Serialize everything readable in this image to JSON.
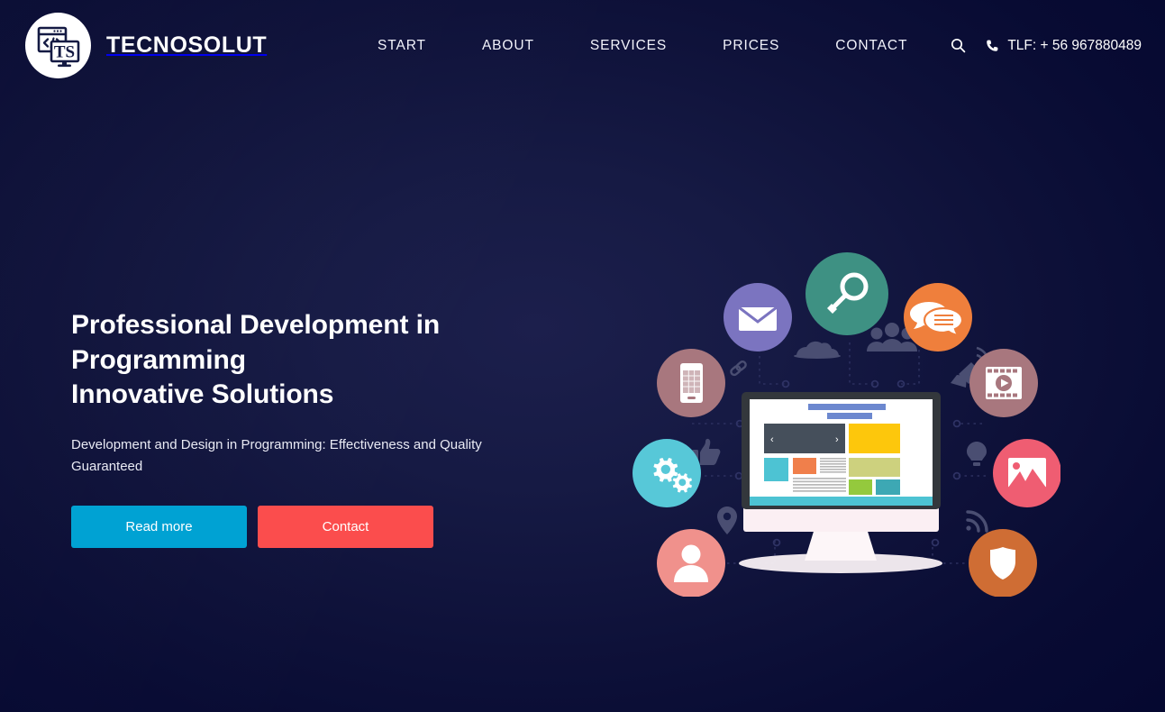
{
  "brand": {
    "name": "TECNOSOLUT",
    "logo_icon": "code-monitor-logo-icon",
    "logo_code_glyph": "</>",
    "logo_initials": "TS"
  },
  "header": {
    "nav_items": [
      {
        "label": "START",
        "name": "nav-item-start"
      },
      {
        "label": "ABOUT",
        "name": "nav-item-about"
      },
      {
        "label": "SERVICES",
        "name": "nav-item-services"
      },
      {
        "label": "PRICES",
        "name": "nav-item-prices"
      },
      {
        "label": "CONTACT",
        "name": "nav-item-contact"
      }
    ],
    "search_icon": "search-icon",
    "phone_icon": "phone-icon",
    "phone_label": "TLF: + 56 967880489"
  },
  "hero": {
    "title_line1": "Professional Development in",
    "title_line2": "Programming",
    "title_line3": "Innovative Solutions",
    "subtitle": "Development and Design in Programming: Effectiveness and Quality Guaranteed",
    "buttons": {
      "read_more": "Read more",
      "contact": "Contact"
    }
  },
  "illustration": {
    "name": "web-development-network-illustration",
    "center_object": "desktop-monitor-with-webpage-layout",
    "carousel_arrow_left": "‹",
    "carousel_arrow_right": "›",
    "icon_bubbles": [
      {
        "name": "search-bubble-icon",
        "icon": "magnifier",
        "color": "#3e9183"
      },
      {
        "name": "email-bubble-icon",
        "icon": "envelope",
        "color": "#7b74c0"
      },
      {
        "name": "chat-bubble-icon",
        "icon": "speech-bubbles",
        "color": "#ef7f3c"
      },
      {
        "name": "mobile-bubble-icon",
        "icon": "smartphone",
        "color": "#a8777e"
      },
      {
        "name": "video-bubble-icon",
        "icon": "film-play",
        "color": "#a8777e"
      },
      {
        "name": "settings-bubble-icon",
        "icon": "gears",
        "color": "#57c8d8"
      },
      {
        "name": "gallery-bubble-icon",
        "icon": "picture",
        "color": "#ef5d72"
      },
      {
        "name": "user-bubble-icon",
        "icon": "person",
        "color": "#f0918c"
      },
      {
        "name": "security-bubble-icon",
        "icon": "shield",
        "color": "#cf6d34"
      }
    ],
    "ghost_icons": [
      {
        "name": "cloud-ghost-icon",
        "icon": "cloud"
      },
      {
        "name": "users-ghost-icon",
        "icon": "users-group"
      },
      {
        "name": "satellite-ghost-icon",
        "icon": "satellite-dish"
      },
      {
        "name": "link-ghost-icon",
        "icon": "chain-link"
      },
      {
        "name": "thumbsup-ghost-icon",
        "icon": "thumbs-up"
      },
      {
        "name": "pin-ghost-icon",
        "icon": "map-pin"
      },
      {
        "name": "bulb-ghost-icon",
        "icon": "light-bulb"
      },
      {
        "name": "rss-ghost-icon",
        "icon": "rss-signal"
      }
    ]
  },
  "colors": {
    "background_dark": "#060a32",
    "background_center": "#1c1f4c",
    "accent_blue": "#00a2d3",
    "accent_red": "#fb4d4d",
    "text_light": "#ffffff"
  }
}
